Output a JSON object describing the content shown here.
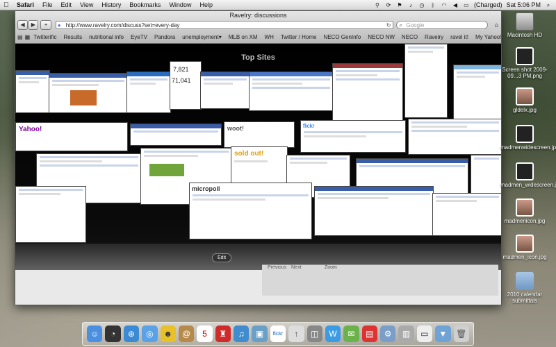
{
  "menubar": {
    "apple": "",
    "app": "Safari",
    "items": [
      "File",
      "Edit",
      "View",
      "History",
      "Bookmarks",
      "Window",
      "Help"
    ],
    "battery": "(Charged)",
    "clock": "Sat 5:06 PM"
  },
  "window": {
    "title": "Ravelry: discussions",
    "url": "http://www.ravelry.com/discuss?set=every-day",
    "search_placeholder": "Google",
    "bookmarks": [
      "Twitterific",
      "Results",
      "nutritional info",
      "EyeTV",
      "Pandora",
      "unemployment▾",
      "MLB on XM",
      "WH",
      "Twitter / Home",
      "NECO GenInfo",
      "NECO NW",
      "NECO",
      "Ravelry",
      "ravel it!",
      "My Yahoo!"
    ]
  },
  "topsites": {
    "title": "Top Sites",
    "edit_label": "Edit",
    "numbers": [
      "7,821",
      "71,041"
    ],
    "labels": [
      "woot!",
      "sold out!",
      "flickr",
      "micropoll",
      "Yahoo!"
    ],
    "strip": [
      "Previous",
      "Next",
      "Zoom"
    ]
  },
  "desktop": {
    "icons": [
      {
        "label": "Macintosh HD"
      },
      {
        "label": "Screen shot 2009-09...3 PM.png"
      },
      {
        "label": "gldelx.jpg"
      },
      {
        "label": "madmenwidescreen.jpg"
      },
      {
        "label": "madmen_widescreen.jpg"
      },
      {
        "label": "madmenicon.jpg"
      },
      {
        "label": "madmen_icon.jpg"
      },
      {
        "label": "2010 calendar submittals"
      }
    ]
  },
  "dock": {
    "items": [
      "Finder",
      "Dashboard",
      "Safari",
      "iChat",
      "Adium",
      "Address Book",
      "iCal",
      "Chair",
      "iTunes",
      "iPhoto",
      "Flickr",
      "Uploader",
      "Boot Camp",
      "Mail",
      "Photo Booth",
      "Calendar",
      "Preview",
      "Stack",
      "Documents",
      "Downloads",
      "Trash"
    ]
  }
}
